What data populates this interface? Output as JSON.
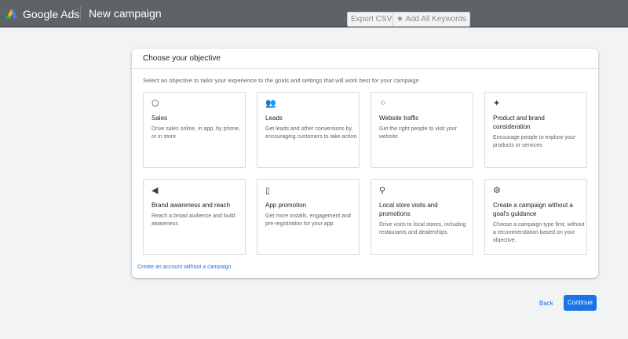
{
  "header": {
    "brand": "Google Ads",
    "page_title": "New campaign",
    "export_csv": "Export CSV",
    "add_keywords": "★ Add All Keywords"
  },
  "card": {
    "title": "Choose your objective",
    "subtitle": "Select an objective to tailor your experience to the goals and settings that will work best for your campaign",
    "tiles": [
      {
        "icon": "tag-icon",
        "glyph": "⬡",
        "title": "Sales",
        "desc": "Drive sales online, in app, by phone, or in store"
      },
      {
        "icon": "people-icon",
        "glyph": "👥",
        "title": "Leads",
        "desc": "Get leads and other conversions by encouraging customers to take action"
      },
      {
        "icon": "cursor-click-icon",
        "glyph": "⁘",
        "title": "Website traffic",
        "desc": "Get the right people to visit your website"
      },
      {
        "icon": "sparkle-icon",
        "glyph": "✦",
        "title": "Product and brand consideration",
        "desc": "Encourage people to explore your products or services"
      },
      {
        "icon": "megaphone-icon",
        "glyph": "◀",
        "title": "Brand awareness and reach",
        "desc": "Reach a broad audience and build awareness"
      },
      {
        "icon": "phone-icon",
        "glyph": "▯",
        "title": "App promotion",
        "desc": "Get more installs, engagement and pre-registration for your app"
      },
      {
        "icon": "location-pin-icon",
        "glyph": "⚲",
        "title": "Local store visits and promotions",
        "desc": "Drive visits to local stores, including restaurants and dealerships."
      },
      {
        "icon": "gear-icon",
        "glyph": "⚙",
        "title": "Create a campaign without a goal's guidance",
        "desc": "Choose a campaign type first, without a recommendation based on your objective."
      }
    ],
    "link": "Create an account without a campaign"
  },
  "footer": {
    "back": "Back",
    "continue": "Continue"
  },
  "colors": {
    "header": "#5f6368",
    "accent": "#1a73e8"
  }
}
